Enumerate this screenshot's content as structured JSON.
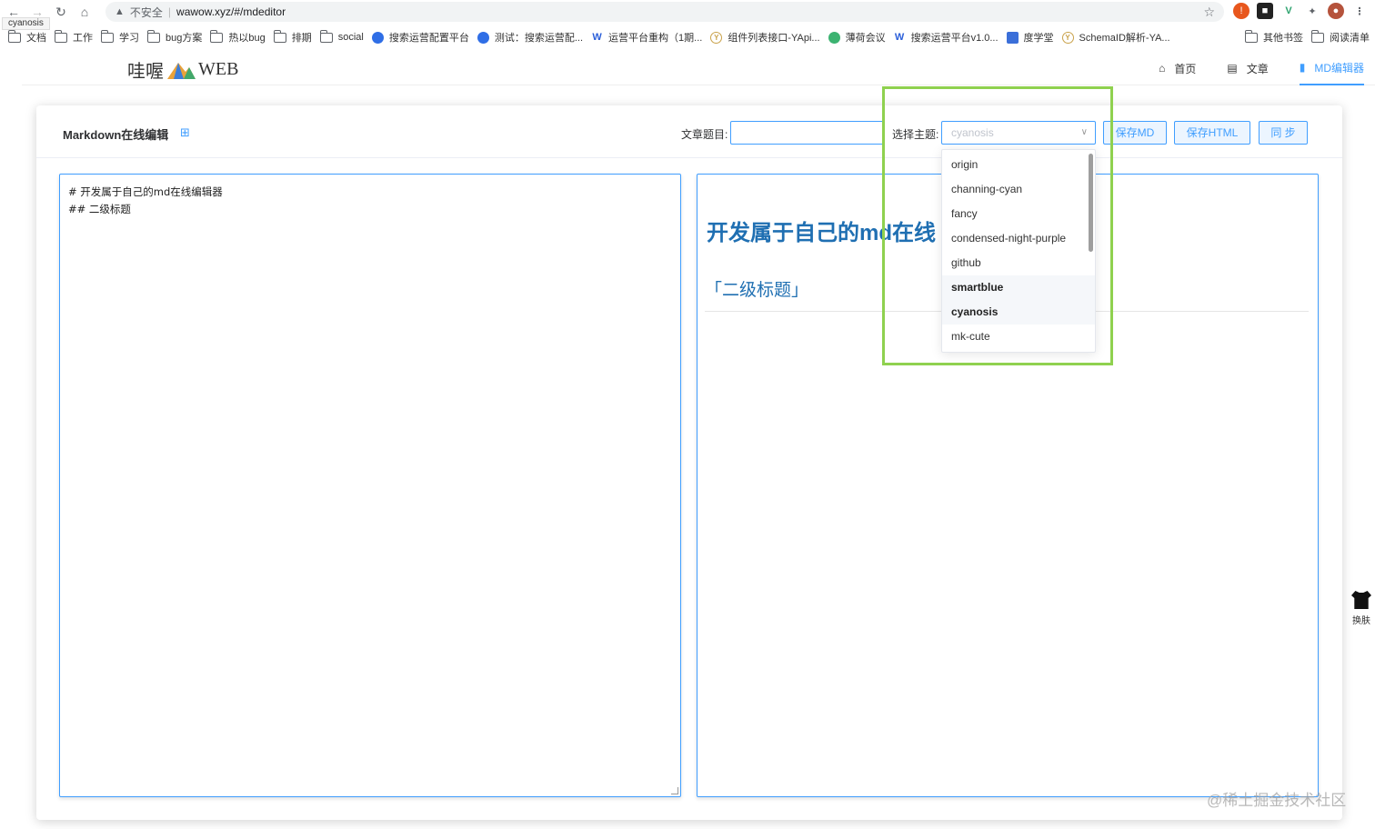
{
  "browser": {
    "tab_tooltip": "cyanosis",
    "insecure_label": "不安全",
    "url": "wawow.xyz/#/mdeditor",
    "bookmarks": [
      {
        "label": "文档",
        "icon": "folder-icon"
      },
      {
        "label": "工作",
        "icon": "folder-icon"
      },
      {
        "label": "学习",
        "icon": "folder-icon"
      },
      {
        "label": "bug方案",
        "icon": "folder-icon"
      },
      {
        "label": "热以bug",
        "icon": "folder-icon"
      },
      {
        "label": "排期",
        "icon": "folder-icon"
      },
      {
        "label": "social",
        "icon": "folder-icon"
      },
      {
        "label": "搜索运营配置平台",
        "icon": "circle-icon",
        "color": "#2f6ee6"
      },
      {
        "label": "测试：搜索运营配...",
        "icon": "circle-icon",
        "color": "#2f6ee6"
      },
      {
        "label": "运营平台重构（1期...",
        "icon": "w-icon",
        "color": "#2b5fd9"
      },
      {
        "label": "组件列表接口-YApi...",
        "icon": "y-icon",
        "color": "#c9a24a"
      },
      {
        "label": "薄荷会议",
        "icon": "leaf-icon",
        "color": "#3cb371"
      },
      {
        "label": "搜索运营平台v1.0...",
        "icon": "w-icon",
        "color": "#2b5fd9"
      },
      {
        "label": "度学堂",
        "icon": "square-icon",
        "color": "#3b6fd9"
      },
      {
        "label": "SchemaID解析-YA...",
        "icon": "y-icon",
        "color": "#c9a24a"
      }
    ],
    "bookmarks_right": [
      {
        "label": "其他书签",
        "icon": "folder-icon"
      },
      {
        "label": "阅读清单",
        "icon": "list-icon"
      }
    ]
  },
  "header": {
    "logo_text_left": "哇喔",
    "logo_text_right": "WEB",
    "nav": [
      {
        "label": "首页",
        "icon": "home-icon",
        "active": false
      },
      {
        "label": "文章",
        "icon": "article-icon",
        "active": false
      },
      {
        "label": "MD编辑器",
        "icon": "document-icon",
        "active": true
      }
    ]
  },
  "toolbar": {
    "title": "Markdown在线编辑",
    "title_icon": "grid-icon",
    "article_title_label": "文章题目:",
    "article_title_value": "",
    "theme_label": "选择主题:",
    "theme_selected": "cyanosis",
    "save_md_label": "保存MD",
    "save_html_label": "保存HTML",
    "sync_label": "同 步"
  },
  "editor": {
    "lines": [
      "# 开发属于自己的md在线编辑器",
      "## 二级标题"
    ]
  },
  "preview": {
    "h1": "开发属于自己的md在线",
    "h2": "「二级标题」"
  },
  "theme_dropdown": {
    "options": [
      "origin",
      "channing-cyan",
      "fancy",
      "condensed-night-purple",
      "github",
      "smartblue",
      "cyanosis",
      "mk-cute"
    ],
    "hovered": "smartblue",
    "selected": "cyanosis"
  },
  "side_widget": {
    "label": "换肤",
    "icon": "shirt-icon"
  },
  "watermark": "@稀土掘金技术社区",
  "colors": {
    "accent": "#409eff",
    "highlight": "#8fd14f",
    "preview_heading": "#1f6fb2"
  }
}
